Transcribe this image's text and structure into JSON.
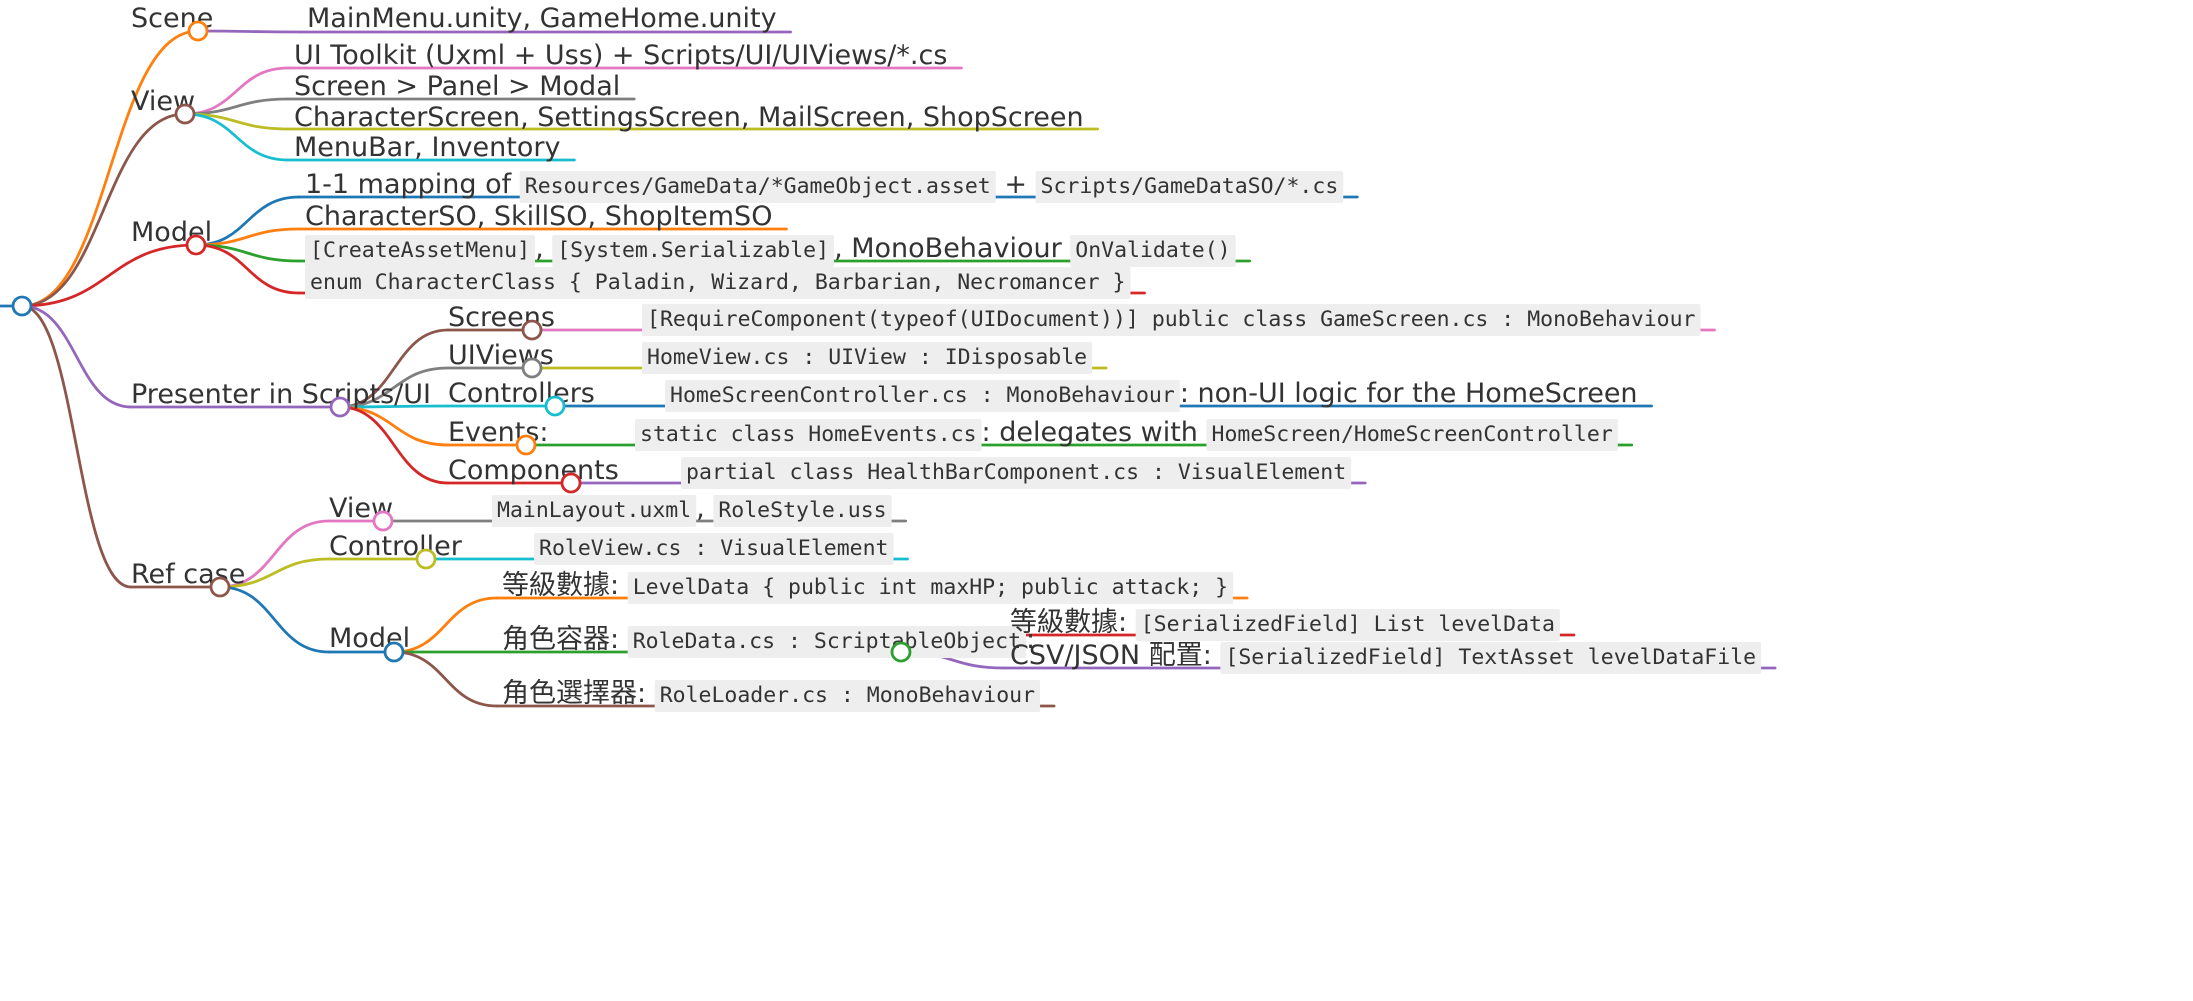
{
  "colors": {
    "orange": "#ff7f0e",
    "brown": "#8c564b",
    "red": "#d62728",
    "purple": "#9467bd",
    "pink": "#e377c2",
    "gray": "#7f7f7f",
    "olive": "#bcbd22",
    "cyan": "#17becf",
    "blue": "#1f77b4",
    "green": "#2ca02c"
  },
  "icons": {
    "node": "circle-node-icon"
  },
  "mindmap": {
    "scene": {
      "label": "Scene",
      "items": [
        {
          "segments": [
            {
              "t": "text",
              "v": "MainMenu.unity, GameHome.unity"
            }
          ]
        }
      ]
    },
    "view": {
      "label": "View",
      "items": [
        {
          "segments": [
            {
              "t": "text",
              "v": "UI Toolkit (Uxml + Uss) + Scripts/UI/UIViews/*.cs"
            }
          ]
        },
        {
          "segments": [
            {
              "t": "text",
              "v": "Screen > Panel > Modal"
            }
          ]
        },
        {
          "segments": [
            {
              "t": "text",
              "v": "CharacterScreen, SettingsScreen, MailScreen, ShopScreen"
            }
          ]
        },
        {
          "segments": [
            {
              "t": "text",
              "v": "MenuBar, Inventory"
            }
          ]
        }
      ]
    },
    "model": {
      "label": "Model",
      "items": [
        {
          "segments": [
            {
              "t": "text",
              "v": "1-1 mapping of "
            },
            {
              "t": "code",
              "v": "Resources/GameData/*GameObject.asset"
            },
            {
              "t": "text",
              "v": " + "
            },
            {
              "t": "code",
              "v": "Scripts/GameDataSO/*.cs"
            }
          ]
        },
        {
          "segments": [
            {
              "t": "text",
              "v": "CharacterSO, SkillSO, ShopItemSO"
            }
          ]
        },
        {
          "segments": [
            {
              "t": "code",
              "v": "[CreateAssetMenu]"
            },
            {
              "t": "text",
              "v": ", "
            },
            {
              "t": "code",
              "v": "[System.Serializable]"
            },
            {
              "t": "text",
              "v": ", MonoBehaviour "
            },
            {
              "t": "code",
              "v": "OnValidate()"
            }
          ]
        },
        {
          "segments": [
            {
              "t": "code",
              "v": "enum CharacterClass { Paladin, Wizard, Barbarian, Necromancer }"
            }
          ]
        }
      ]
    },
    "presenter": {
      "label": "Presenter in Scripts/UI",
      "children": [
        {
          "label": "Screens",
          "segments": [
            {
              "t": "code",
              "v": "[RequireComponent(typeof(UIDocument))] public class GameScreen.cs : MonoBehaviour"
            }
          ]
        },
        {
          "label": "UIViews",
          "segments": [
            {
              "t": "code",
              "v": "HomeView.cs : UIView : IDisposable"
            }
          ]
        },
        {
          "label": "Controllers",
          "segments": [
            {
              "t": "code",
              "v": "HomeScreenController.cs : MonoBehaviour"
            },
            {
              "t": "text",
              "v": ": non-UI logic for the HomeScreen"
            }
          ]
        },
        {
          "label": "Events:",
          "segments": [
            {
              "t": "code",
              "v": "static class HomeEvents.cs"
            },
            {
              "t": "text",
              "v": ": delegates with "
            },
            {
              "t": "code",
              "v": "HomeScreen/HomeScreenController"
            }
          ]
        },
        {
          "label": "Components",
          "segments": [
            {
              "t": "code",
              "v": "partial class HealthBarComponent.cs : VisualElement"
            }
          ]
        }
      ]
    },
    "refcase": {
      "label": "Ref case",
      "view": {
        "label": "View",
        "segments": [
          {
            "t": "code",
            "v": "MainLayout.uxml"
          },
          {
            "t": "text",
            "v": ", "
          },
          {
            "t": "code",
            "v": "RoleStyle.uss"
          }
        ]
      },
      "controller": {
        "label": "Controller",
        "segments": [
          {
            "t": "code",
            "v": "RoleView.cs : VisualElement"
          }
        ]
      },
      "model": {
        "label": "Model",
        "levelData": {
          "segments": [
            {
              "t": "text",
              "v": "等級數據: "
            },
            {
              "t": "code",
              "v": "LevelData { public int maxHP; public attack; }"
            }
          ]
        },
        "roleContainer": {
          "segments": [
            {
              "t": "text",
              "v": "角色容器: "
            },
            {
              "t": "code",
              "v": "RoleData.cs : ScriptableObject"
            },
            {
              "t": "text",
              "v": ":"
            }
          ],
          "children": [
            {
              "segments": [
                {
                  "t": "text",
                  "v": "等級數據: "
                },
                {
                  "t": "code",
                  "v": "[SerializedField] List levelData"
                }
              ]
            },
            {
              "segments": [
                {
                  "t": "text",
                  "v": "CSV/JSON 配置: "
                },
                {
                  "t": "code",
                  "v": "[SerializedField] TextAsset levelDataFile"
                }
              ]
            }
          ]
        },
        "roleLoader": {
          "segments": [
            {
              "t": "text",
              "v": "角色選擇器: "
            },
            {
              "t": "code",
              "v": "RoleLoader.cs : MonoBehaviour"
            }
          ]
        }
      }
    }
  }
}
